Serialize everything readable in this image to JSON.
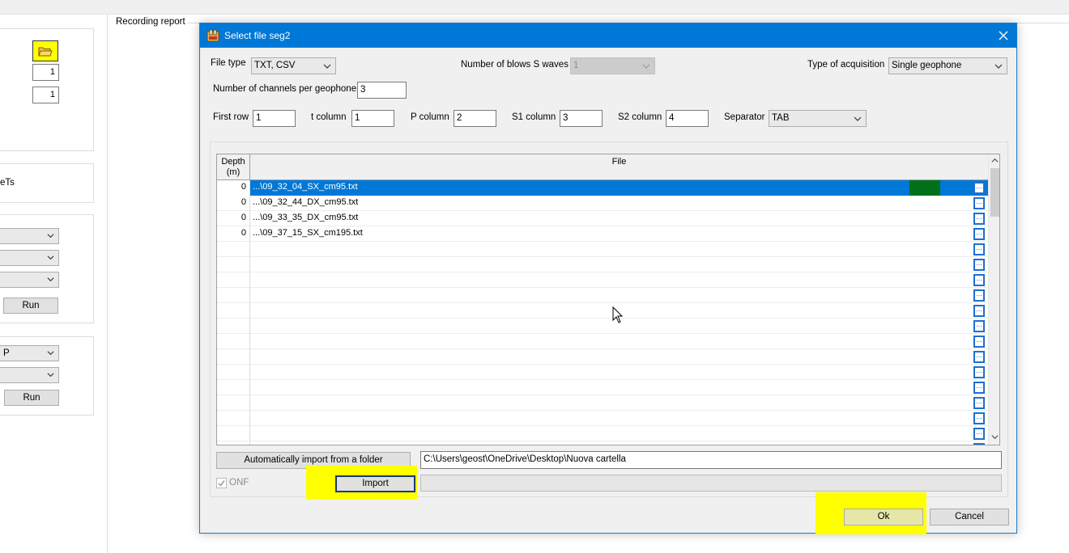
{
  "background": {
    "recording_report_label": "Recording report",
    "numbers": [
      "1",
      "1"
    ],
    "partial_label": "eTs",
    "run_label": "Run",
    "combo_partial_value": "P"
  },
  "dialog": {
    "title": "Select file seg2",
    "file_type": {
      "label": "File type",
      "value": "TXT, CSV"
    },
    "blows": {
      "label": "Number of blows S waves",
      "value": "1"
    },
    "acquisition": {
      "label": "Type of acquisition",
      "value": "Single geophone"
    },
    "channels": {
      "label": "Number of channels per geophone",
      "value": "3"
    },
    "first_row": {
      "label": "First row",
      "value": "1"
    },
    "t_column": {
      "label": "t column",
      "value": "1"
    },
    "p_column": {
      "label": "P column",
      "value": "2"
    },
    "s1_column": {
      "label": "S1 column",
      "value": "3"
    },
    "s2_column": {
      "label": "S2 column",
      "value": "4"
    },
    "separator": {
      "label": "Separator",
      "value": "TAB"
    },
    "grid": {
      "depth_header_1": "Depth",
      "depth_header_2": "(m)",
      "file_header": "File",
      "browse_glyph": "...",
      "rows": [
        {
          "depth": "0",
          "file": "...\\09_32_04_SX_cm95.txt",
          "selected": true
        },
        {
          "depth": "0",
          "file": "...\\09_32_44_DX_cm95.txt",
          "selected": false
        },
        {
          "depth": "0",
          "file": "...\\09_33_35_DX_cm95.txt",
          "selected": false
        },
        {
          "depth": "0",
          "file": "...\\09_37_15_SX_cm195.txt",
          "selected": false
        },
        {
          "depth": "",
          "file": "",
          "selected": false
        },
        {
          "depth": "",
          "file": "",
          "selected": false
        },
        {
          "depth": "",
          "file": "",
          "selected": false
        },
        {
          "depth": "",
          "file": "",
          "selected": false
        },
        {
          "depth": "",
          "file": "",
          "selected": false
        },
        {
          "depth": "",
          "file": "",
          "selected": false
        },
        {
          "depth": "",
          "file": "",
          "selected": false
        },
        {
          "depth": "",
          "file": "",
          "selected": false
        },
        {
          "depth": "",
          "file": "",
          "selected": false
        },
        {
          "depth": "",
          "file": "",
          "selected": false
        },
        {
          "depth": "",
          "file": "",
          "selected": false
        },
        {
          "depth": "",
          "file": "",
          "selected": false
        },
        {
          "depth": "",
          "file": "",
          "selected": false
        },
        {
          "depth": "",
          "file": "",
          "selected": false
        }
      ]
    },
    "auto_import_label": "Automatically import from a folder",
    "folder_path": "C:\\Users\\geost\\OneDrive\\Desktop\\Nuova cartella",
    "onf_label": "ONF",
    "import_label": "Import",
    "ok_label": "Ok",
    "cancel_label": "Cancel"
  },
  "colors": {
    "titlebar": "#0078d7",
    "highlight": "#ffff00",
    "selection": "#0078d7",
    "green_cell": "#00701a",
    "browse_border": "#1e6fd0"
  },
  "icons": [
    "folder-open-icon",
    "dialog-app-icon",
    "close-icon",
    "chevron-down-icon",
    "mouse-cursor-icon",
    "browse-ellipsis-icon"
  ]
}
